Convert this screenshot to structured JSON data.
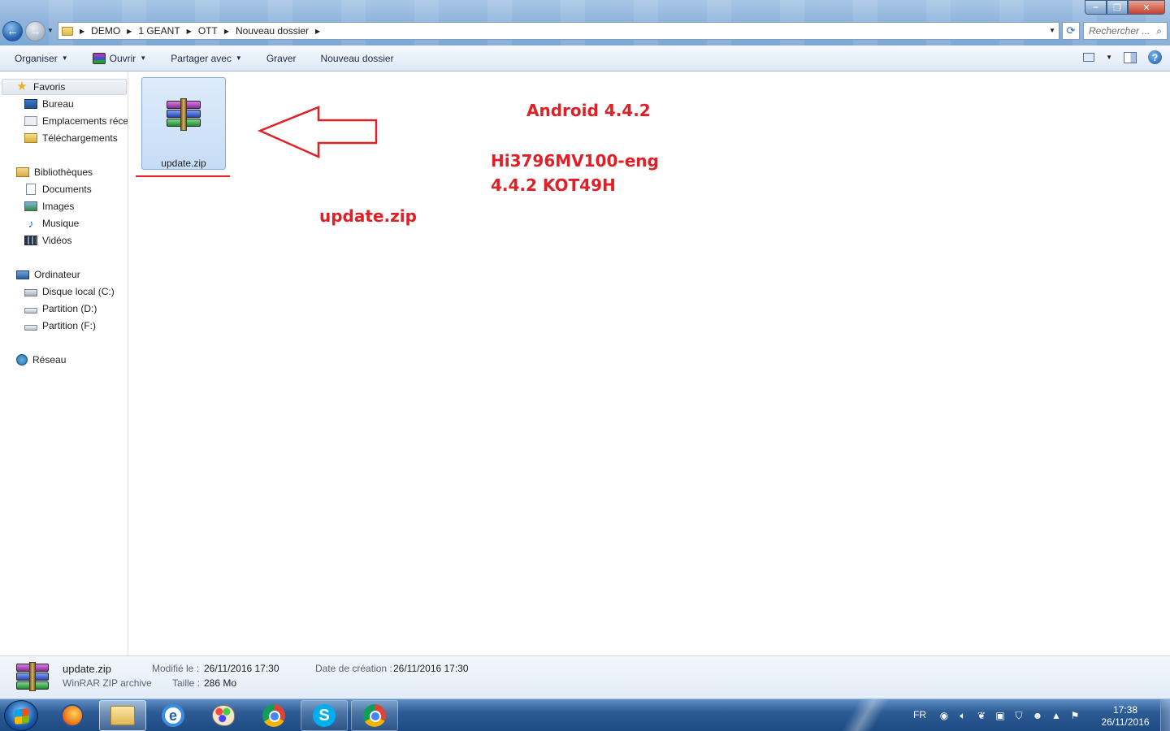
{
  "window": {
    "controls": {
      "minimize": "–",
      "maximize": "❐",
      "close": "✕"
    }
  },
  "address": {
    "breadcrumb": [
      "DEMO",
      "1 GEANT",
      "OTT",
      "Nouveau dossier"
    ],
    "search_placeholder": "Rechercher ...",
    "back_glyph": "←",
    "forward_glyph": "→",
    "refresh_glyph": "⟳",
    "search_glyph": "⌕"
  },
  "toolbar": {
    "organize": "Organiser",
    "open": "Ouvrir",
    "share": "Partager avec",
    "burn": "Graver",
    "new_folder": "Nouveau dossier",
    "help": "?"
  },
  "sidebar": {
    "favorites": {
      "label": "Favoris",
      "items": [
        "Bureau",
        "Emplacements récents",
        "Téléchargements"
      ]
    },
    "libraries": {
      "label": "Bibliothèques",
      "items": [
        "Documents",
        "Images",
        "Musique",
        "Vidéos"
      ]
    },
    "computer": {
      "label": "Ordinateur",
      "items": [
        "Disque local (C:)",
        "Partition (D:)",
        "Partition (F:)"
      ]
    },
    "network": {
      "label": "Réseau"
    }
  },
  "content": {
    "file": {
      "name": "update.zip",
      "icon": "winrar-archive-icon"
    },
    "annotations": {
      "android": "Android 4.4.2",
      "build_line1": "Hi3796MV100-eng",
      "build_line2": "4.4.2 KOT49H",
      "filename": "update.zip"
    },
    "annotation_color": "#df2027"
  },
  "details": {
    "name": "update.zip",
    "type": "WinRAR ZIP archive",
    "modified_label": "Modifié le :",
    "modified_value": "26/11/2016 17:30",
    "size_label": "Taille :",
    "size_value": "286 Mo",
    "created_label": "Date de création :",
    "created_value": "26/11/2016 17:30"
  },
  "taskbar": {
    "apps": [
      "firefox-icon",
      "explorer-icon",
      "internet-explorer-icon",
      "paint-icon",
      "chrome-icon",
      "skype-icon",
      "chrome-icon"
    ],
    "ie_glyph": "e",
    "skype_glyph": "S",
    "language": "FR",
    "time": "17:38",
    "date": "26/11/2016"
  }
}
